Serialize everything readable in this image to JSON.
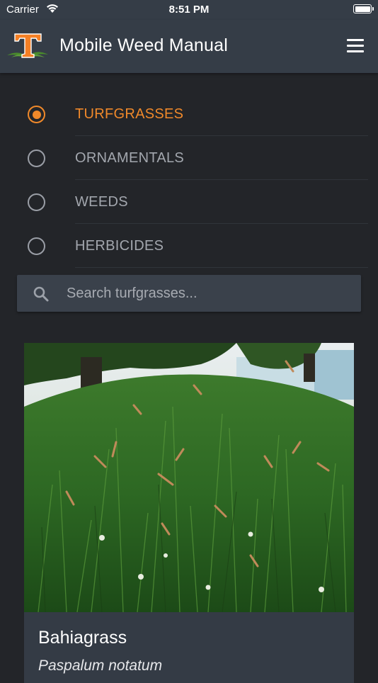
{
  "status_bar": {
    "carrier": "Carrier",
    "time": "8:51 PM",
    "icons": [
      "wifi-icon",
      "battery-icon"
    ]
  },
  "header": {
    "logo_letter": "T",
    "title": "Mobile Weed Manual",
    "menu_icon": "hamburger-menu-icon"
  },
  "categories": [
    {
      "label": "TURFGRASSES",
      "selected": true
    },
    {
      "label": "ORNAMENTALS",
      "selected": false
    },
    {
      "label": "WEEDS",
      "selected": false
    },
    {
      "label": "HERBICIDES",
      "selected": false
    }
  ],
  "search": {
    "placeholder": "Search turfgrasses...",
    "value": "",
    "icon": "search-icon"
  },
  "results": [
    {
      "common_name": "Bahiagrass",
      "scientific_name": "Paspalum notatum",
      "image": "turfgrass-photo"
    }
  ],
  "colors": {
    "accent": "#f0892a",
    "header_bg": "#353d47",
    "page_bg": "#232529",
    "card_bg": "#343b45",
    "muted_text": "#a3a7ae",
    "logo_orange": "#f58025",
    "logo_green": "#4a8b2c"
  }
}
